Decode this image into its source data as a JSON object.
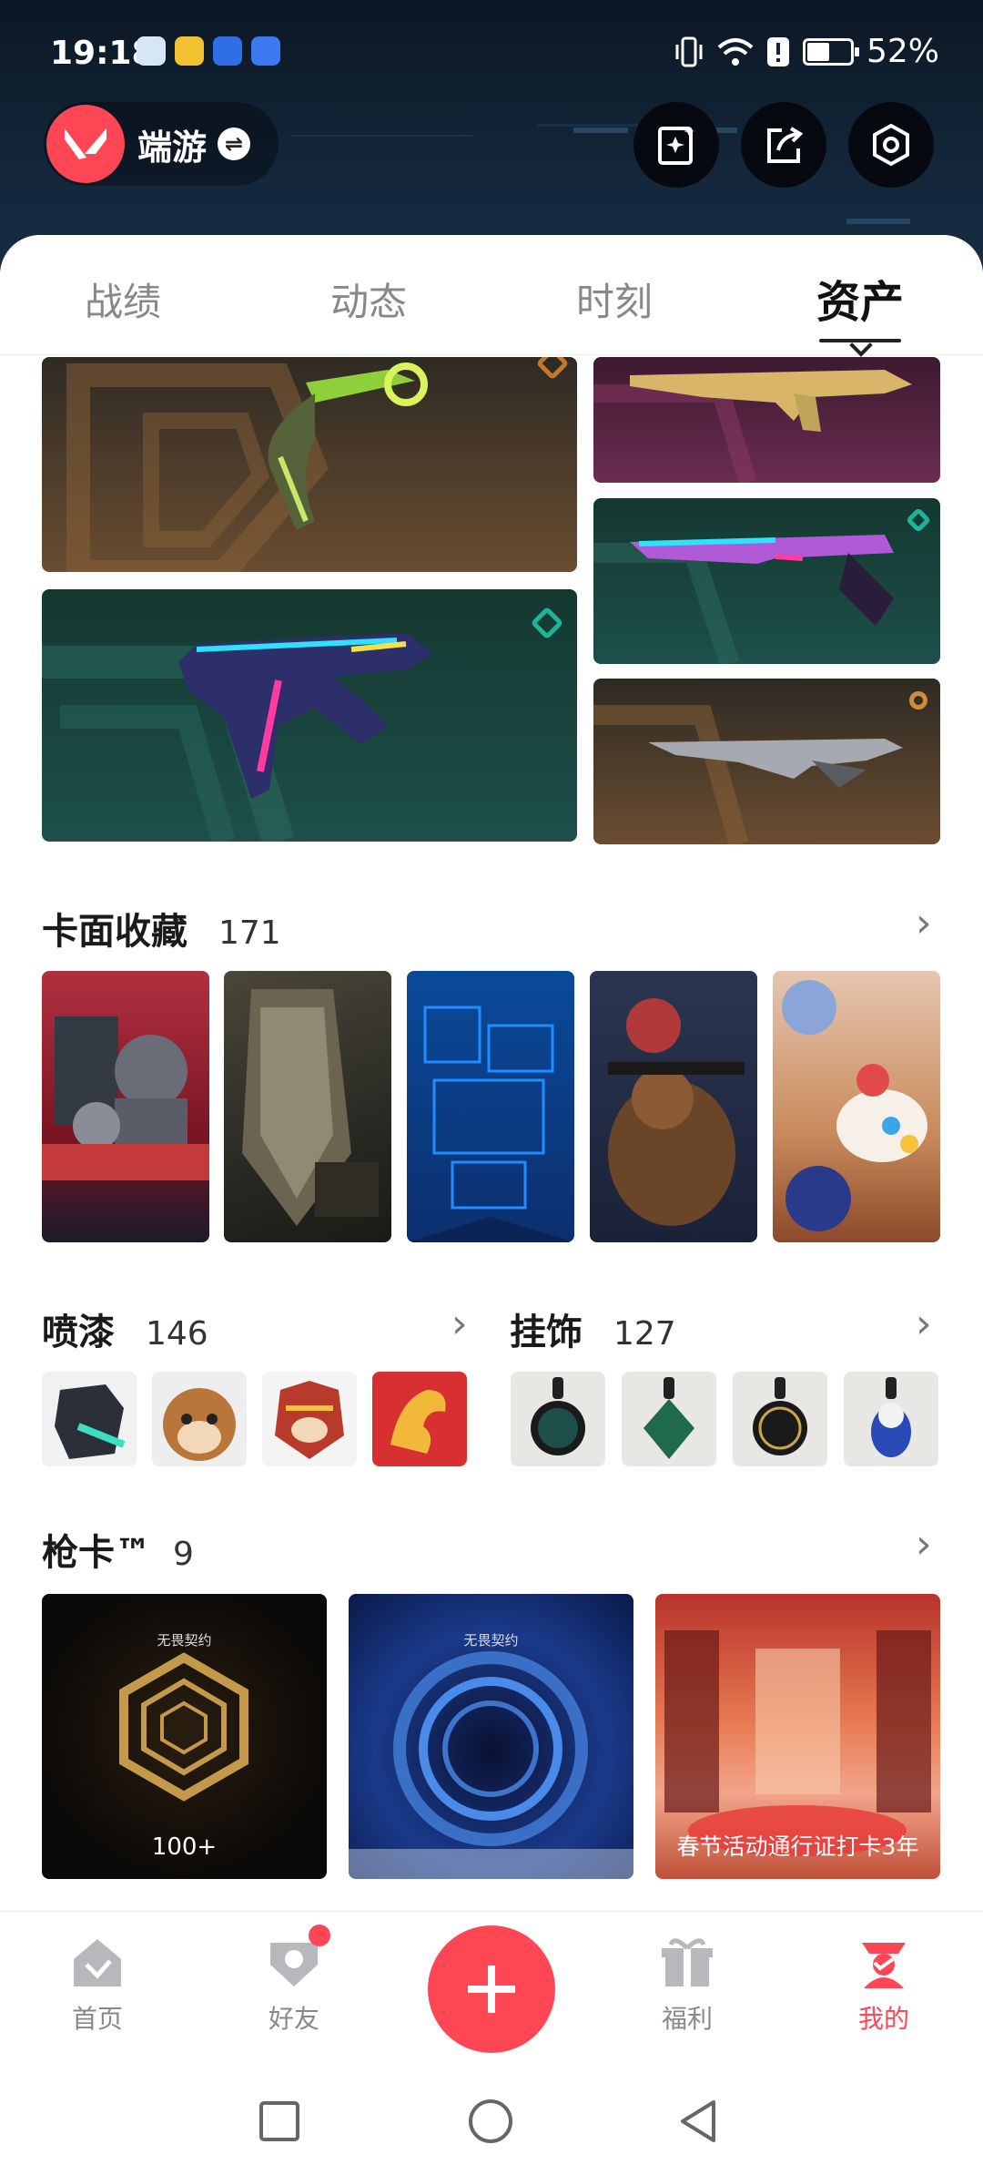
{
  "status_bar": {
    "time": "19:18",
    "battery": "52%"
  },
  "header": {
    "name": "端游",
    "swap_label": "⇌"
  },
  "tabs": [
    "战绩",
    "动态",
    "时刻",
    "资产"
  ],
  "active_tab": 3,
  "sections": {
    "cards": {
      "title": "卡面收藏",
      "count": "171"
    },
    "sprays": {
      "title": "喷漆",
      "count": "146"
    },
    "charms": {
      "title": "挂饰",
      "count": "127"
    },
    "gun_cards": {
      "title": "枪卡™",
      "count": "9"
    }
  },
  "gun_cards": [
    {
      "label": "100+",
      "brand": "无畏契约"
    },
    {
      "label": "",
      "brand": "无畏契约"
    },
    {
      "label": "春节活动通行证打卡3年",
      "brand": ""
    }
  ],
  "nav": [
    "首页",
    "好友",
    "福利",
    "我的"
  ],
  "colors": {
    "accent": "#ff4655",
    "teal_tile": "#1e4f4a",
    "bronze_tile": "#5e4530",
    "purple_tile": "#5e2846"
  },
  "icons": [
    "valorant-logo-icon",
    "collection-icon",
    "share-icon",
    "settings-icon",
    "home-icon",
    "friends-icon",
    "plus-icon",
    "gift-icon",
    "profile-icon"
  ]
}
